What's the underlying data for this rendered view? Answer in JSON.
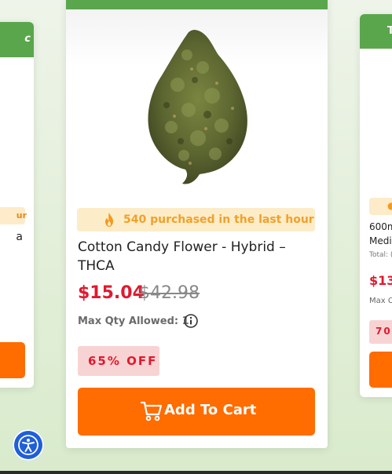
{
  "left_card": {
    "banner_text": "c",
    "pill_text": "ur",
    "title_fragment": "a"
  },
  "main_card": {
    "purchase_text": "540 purchased in the last hour",
    "title": "Cotton Candy Flower - Hybrid – THCA",
    "price_now": "$15.04",
    "price_was": "$42.98",
    "max_qty": "Max Qty Allowed: 1",
    "discount": "65% OFF",
    "cta_label": "Add To Cart"
  },
  "right_card": {
    "banner_text": "T",
    "title_line1": "600m",
    "title_line2": "Medi",
    "subtitle": "Total: (",
    "price": "$13.",
    "max_qty": "Max C",
    "discount": "70%"
  },
  "icons": {
    "flame": "flame-icon",
    "info": "info-icon",
    "cart": "cart-icon",
    "accessibility": "accessibility-icon"
  },
  "colors": {
    "brand_green": "#5aa64c",
    "cta_orange": "#ff6c00",
    "price_red": "#e0192e",
    "pill_bg": "#fdecc8",
    "discount_bg": "#f8d3d3",
    "a11y_blue": "#1f5fd8"
  }
}
